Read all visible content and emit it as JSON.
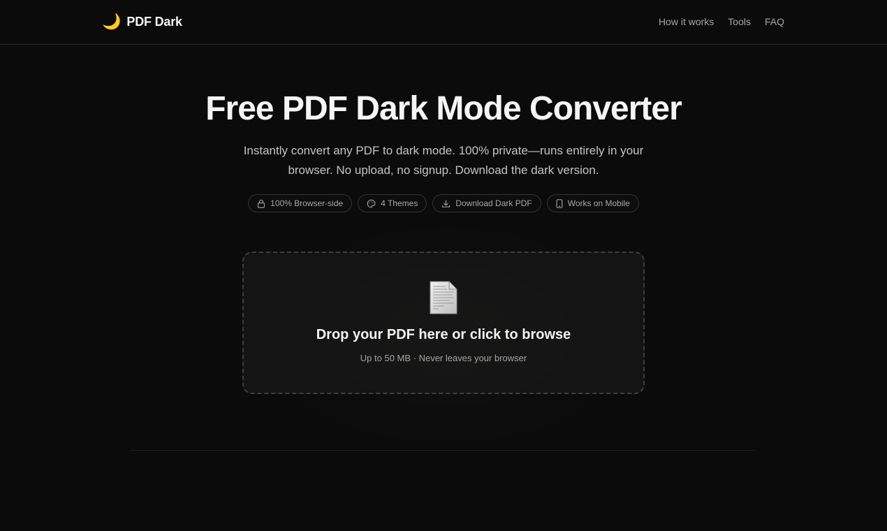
{
  "header": {
    "brand_icon": "🌙",
    "brand_name": "PDF Dark",
    "nav": [
      {
        "label": "How it works"
      },
      {
        "label": "Tools"
      },
      {
        "label": "FAQ"
      }
    ]
  },
  "hero": {
    "title": "Free PDF Dark Mode Converter",
    "subtitle": "Instantly convert any PDF to dark mode. 100% private—runs entirely in your browser. No upload, no signup. Download the dark version."
  },
  "badges": [
    {
      "icon": "lock-icon",
      "label": "100% Browser-side"
    },
    {
      "icon": "palette-icon",
      "label": "4 Themes"
    },
    {
      "icon": "download-icon",
      "label": "Download Dark PDF"
    },
    {
      "icon": "mobile-icon",
      "label": "Works on Mobile"
    }
  ],
  "dropzone": {
    "icon": "document-icon",
    "title": "Drop your PDF here or click to browse",
    "hint": "Up to 50 MB · Never leaves your browser"
  },
  "colors": {
    "background": "#0b0b0b",
    "text": "#ededed",
    "muted": "#a6a6a6",
    "border": "#333333"
  }
}
